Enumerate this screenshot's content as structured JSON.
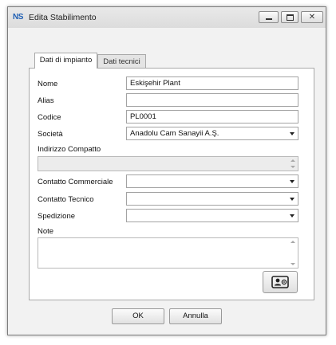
{
  "window": {
    "app_icon_text": "NS",
    "title": "Edita Stabilimento"
  },
  "tabs": [
    {
      "label": "Dati di impianto",
      "active": true
    },
    {
      "label": "Dati tecnici",
      "active": false
    }
  ],
  "form": {
    "nome": {
      "label": "Nome",
      "value": "Eskişehir Plant"
    },
    "alias": {
      "label": "Alias",
      "value": ""
    },
    "codice": {
      "label": "Codice",
      "value": "PL0001"
    },
    "societa": {
      "label": "Società",
      "value": "Anadolu Cam Sanayii A.Ş."
    },
    "indirizzo": {
      "label": "Indirizzo Compatto",
      "value": ""
    },
    "contatto_commerciale": {
      "label": "Contatto Commerciale",
      "value": ""
    },
    "contatto_tecnico": {
      "label": "Contatto Tecnico",
      "value": ""
    },
    "spedizione": {
      "label": "Spedizione",
      "value": ""
    },
    "note": {
      "label": "Note",
      "value": ""
    }
  },
  "buttons": {
    "ok": "OK",
    "cancel": "Annulla"
  },
  "icons": {
    "card_button_icon": "contact-card-icon"
  }
}
